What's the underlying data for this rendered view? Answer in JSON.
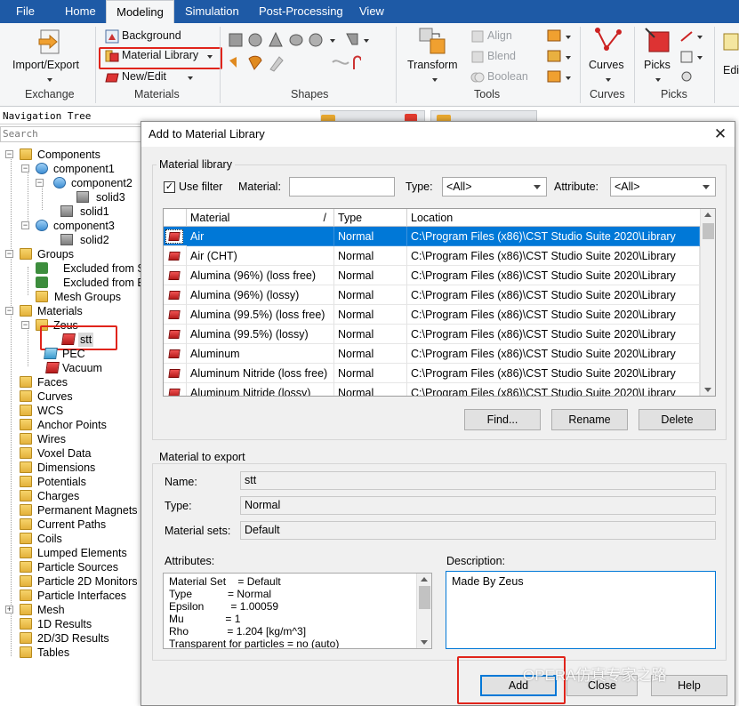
{
  "menubar": {
    "items": [
      "File",
      "Home",
      "Modeling",
      "Simulation",
      "Post-Processing",
      "View"
    ],
    "active": "Modeling"
  },
  "ribbon": {
    "import_export": "Import/Export",
    "exchange": "Exchange",
    "background": "Background",
    "material_library": "Material Library",
    "new_edit": "New/Edit",
    "materials": "Materials",
    "shapes": "Shapes",
    "transform": "Transform",
    "align": "Align",
    "blend": "Blend",
    "boolean": "Boolean",
    "tools": "Tools",
    "curves": "Curves",
    "curves_group": "Curves",
    "picks": "Picks",
    "picks_group": "Picks",
    "edit_partial": "Edi"
  },
  "nav": {
    "title": "Navigation Tree",
    "search_placeholder": "Search",
    "tree": [
      "Components",
      "component1",
      "component2",
      "solid3",
      "solid1",
      "component3",
      "solid2",
      "Groups",
      "Excluded from S",
      "Excluded from B",
      "Mesh Groups",
      "Materials",
      "Zeus",
      "stt",
      "PEC",
      "Vacuum",
      "Faces",
      "Curves",
      "WCS",
      "Anchor Points",
      "Wires",
      "Voxel Data",
      "Dimensions",
      "Potentials",
      "Charges",
      "Permanent Magnets",
      "Current Paths",
      "Coils",
      "Lumped Elements",
      "Particle Sources",
      "Particle 2D Monitors",
      "Particle Interfaces",
      "Mesh",
      "1D Results",
      "2D/3D Results",
      "Tables"
    ]
  },
  "dialog": {
    "title": "Add to Material Library",
    "library_legend": "Material library",
    "use_filter": "Use filter",
    "material_label": "Material:",
    "material_value": "",
    "type_label": "Type:",
    "type_value": "<All>",
    "attribute_label": "Attribute:",
    "attribute_value": "<All>",
    "table": {
      "columns": [
        "Material",
        "Type",
        "Location"
      ],
      "sort_indicator": "/",
      "rows": [
        {
          "material": "Air",
          "type": "Normal",
          "location": "C:\\Program Files (x86)\\CST Studio Suite 2020\\Library"
        },
        {
          "material": "Air (CHT)",
          "type": "Normal",
          "location": "C:\\Program Files (x86)\\CST Studio Suite 2020\\Library"
        },
        {
          "material": "Alumina (96%) (loss free)",
          "type": "Normal",
          "location": "C:\\Program Files (x86)\\CST Studio Suite 2020\\Library"
        },
        {
          "material": "Alumina (96%) (lossy)",
          "type": "Normal",
          "location": "C:\\Program Files (x86)\\CST Studio Suite 2020\\Library"
        },
        {
          "material": "Alumina (99.5%) (loss free)",
          "type": "Normal",
          "location": "C:\\Program Files (x86)\\CST Studio Suite 2020\\Library"
        },
        {
          "material": "Alumina (99.5%) (lossy)",
          "type": "Normal",
          "location": "C:\\Program Files (x86)\\CST Studio Suite 2020\\Library"
        },
        {
          "material": "Aluminum",
          "type": "Normal",
          "location": "C:\\Program Files (x86)\\CST Studio Suite 2020\\Library"
        },
        {
          "material": "Aluminum Nitride (loss free)",
          "type": "Normal",
          "location": "C:\\Program Files (x86)\\CST Studio Suite 2020\\Library"
        },
        {
          "material": "Aluminum Nitride (lossy)",
          "type": "Normal",
          "location": "C:\\Program Files (x86)\\CST Studio Suite 2020\\Library"
        }
      ]
    },
    "find_button": "Find...",
    "rename_button": "Rename",
    "delete_button": "Delete",
    "export_legend": "Material to export",
    "name_label": "Name:",
    "name_value": "stt",
    "type2_label": "Type:",
    "type2_value": "Normal",
    "sets_label": "Material sets:",
    "sets_value": "Default",
    "attributes_label": "Attributes:",
    "attributes": [
      "Material Set    = Default",
      "Type            = Normal",
      "Epsilon         = 1.00059",
      "Mu              = 1",
      "Rho             = 1.204 [kg/m^3]",
      "Transparent for particles = no (auto)"
    ],
    "description_label": "Description:",
    "description_value": "Made By Zeus",
    "add_button": "Add",
    "close_button": "Close",
    "help_button": "Help"
  },
  "watermark": "OPERA仿真专家之路",
  "colors": {
    "menubar": "#1e5aa6",
    "highlight": "#e0241b",
    "selection": "#0078d7"
  }
}
